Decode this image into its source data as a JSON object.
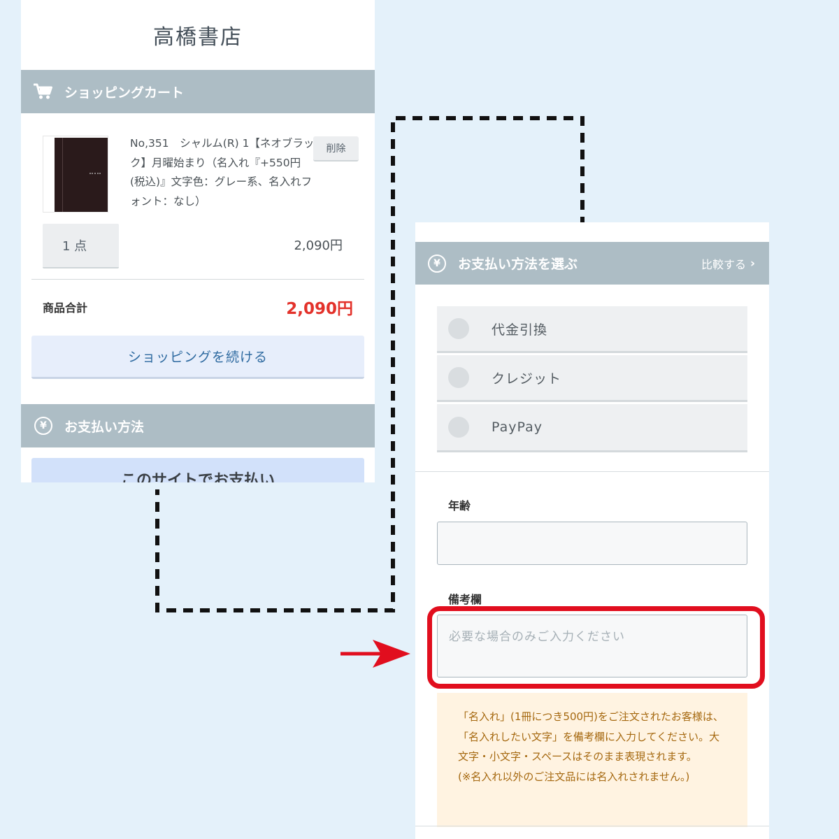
{
  "shop": {
    "title": "高橋書店"
  },
  "cart": {
    "header": "ショッピングカート",
    "item": {
      "name": "No,351　シャルム(R) 1【ネオブラック】月曜始まり（名入れ『+550円(税込)』文字色：グレー系、名入れフォント：なし）",
      "delete_label": "削除",
      "quantity": "1 点",
      "price": "2,090円"
    },
    "subtotal_label": "商品合計",
    "subtotal_value": "2,090円",
    "continue_label": "ショッピングを続ける"
  },
  "payment_left": {
    "header": "お支払い方法",
    "site_pay_label": "このサイトでお支払い"
  },
  "payment_right": {
    "header": "お支払い方法を選ぶ",
    "compare_label": "比較する",
    "options": [
      "代金引換",
      "クレジット",
      "PayPay"
    ]
  },
  "form": {
    "age_label": "年齢",
    "notes_label": "備考欄",
    "notes_placeholder": "必要な場合のみご入力ください"
  },
  "notice": {
    "paragraph": "「名入れ」(1冊につき500円)をご注文されたお客様は、「名入れしたい文字」を備考欄に入力してください。大文字・小文字・スペースはそのまま表現されます。",
    "note": "(※名入れ以外のご注文品には名入れされません。)"
  },
  "colors": {
    "section_header": "#adbdc5",
    "price_red": "#e3322b",
    "highlight_red": "#e10e1e",
    "notice_text": "#a5680f",
    "background": "#e4f1fa"
  },
  "icons": {
    "cart": "cart-icon",
    "yen": "yen-icon",
    "chevron": "chevron-right-icon",
    "arrow": "arrow-right-icon"
  }
}
